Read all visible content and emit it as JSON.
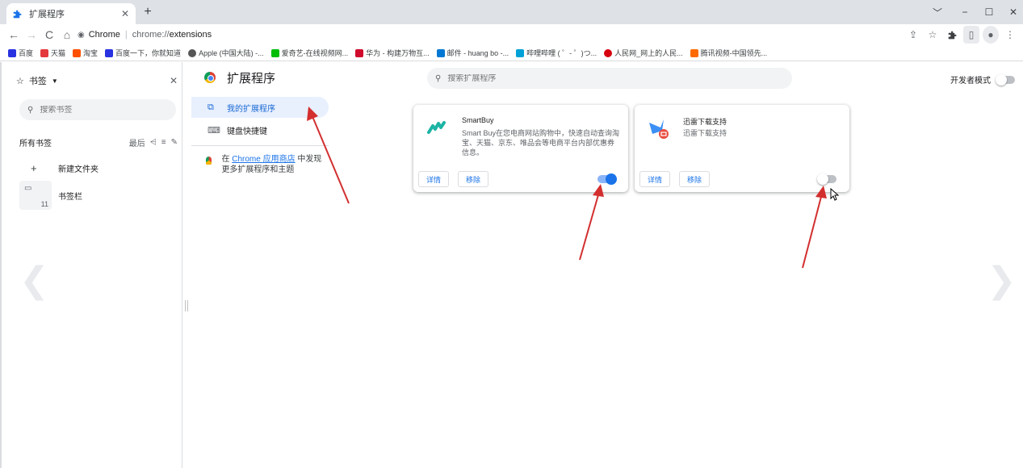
{
  "browser": {
    "tab_title": "扩展程序",
    "new_tab": "+",
    "window_controls": [
      "﹀",
      "−",
      "☐",
      "✕"
    ],
    "site_label": "Chrome",
    "url_host": "chrome://",
    "url_path": "extensions"
  },
  "bookmarks_bar": [
    {
      "label": "百度",
      "color": "#2932e1"
    },
    {
      "label": "天猫",
      "color": "#e4393c"
    },
    {
      "label": "淘宝",
      "color": "#ff5000"
    },
    {
      "label": "百度一下，你就知道",
      "color": "#2932e1"
    },
    {
      "label": "Apple (中国大陆) -...",
      "color": "#555555"
    },
    {
      "label": "爱奇艺-在线视频网...",
      "color": "#00be06"
    },
    {
      "label": "华为 - 构建万物互...",
      "color": "#cf0a2c"
    },
    {
      "label": "邮件 - huang bo -...",
      "color": "#0078d4"
    },
    {
      "label": "哔哩哔哩 ( ゜- ゜)つ...",
      "color": "#00a1d6"
    },
    {
      "label": "人民网_网上的人民...",
      "color": "#d6000f"
    },
    {
      "label": "腾讯视频-中国领先...",
      "color": "#ff6a00"
    }
  ],
  "side_panel": {
    "header": "书签",
    "search_placeholder": "搜索书签",
    "all_bookmarks": "所有书签",
    "sort_label": "最后",
    "new_folder": "新建文件夹",
    "bookmarks_bar_label": "书签栏",
    "bookmarks_bar_count": "11"
  },
  "extensions_page": {
    "title": "扩展程序",
    "search_placeholder": "搜索扩展程序",
    "dev_mode_label": "开发者模式",
    "dev_mode_on": false,
    "nav": [
      {
        "label": "我的扩展程序",
        "active": true
      },
      {
        "label": "键盘快捷键",
        "active": false
      }
    ],
    "webstore_prefix": "在",
    "webstore_link": "Chrome 应用商店",
    "webstore_suffix": "中发现更多扩展程序和主题",
    "cards": [
      {
        "name": "SmartBuy",
        "description": "Smart Buy在您电商网站购物中，快速自动查询淘宝、天猫、京东、唯品会等电商平台内部优惠券信息。",
        "details_label": "详情",
        "remove_label": "移除",
        "enabled": true
      },
      {
        "name": "迅雷下载支持",
        "description": "迅雷下载支持",
        "details_label": "详情",
        "remove_label": "移除",
        "enabled": false
      }
    ]
  },
  "colors": {
    "accent": "#1a73e8",
    "arrow": "#d32f2f"
  }
}
